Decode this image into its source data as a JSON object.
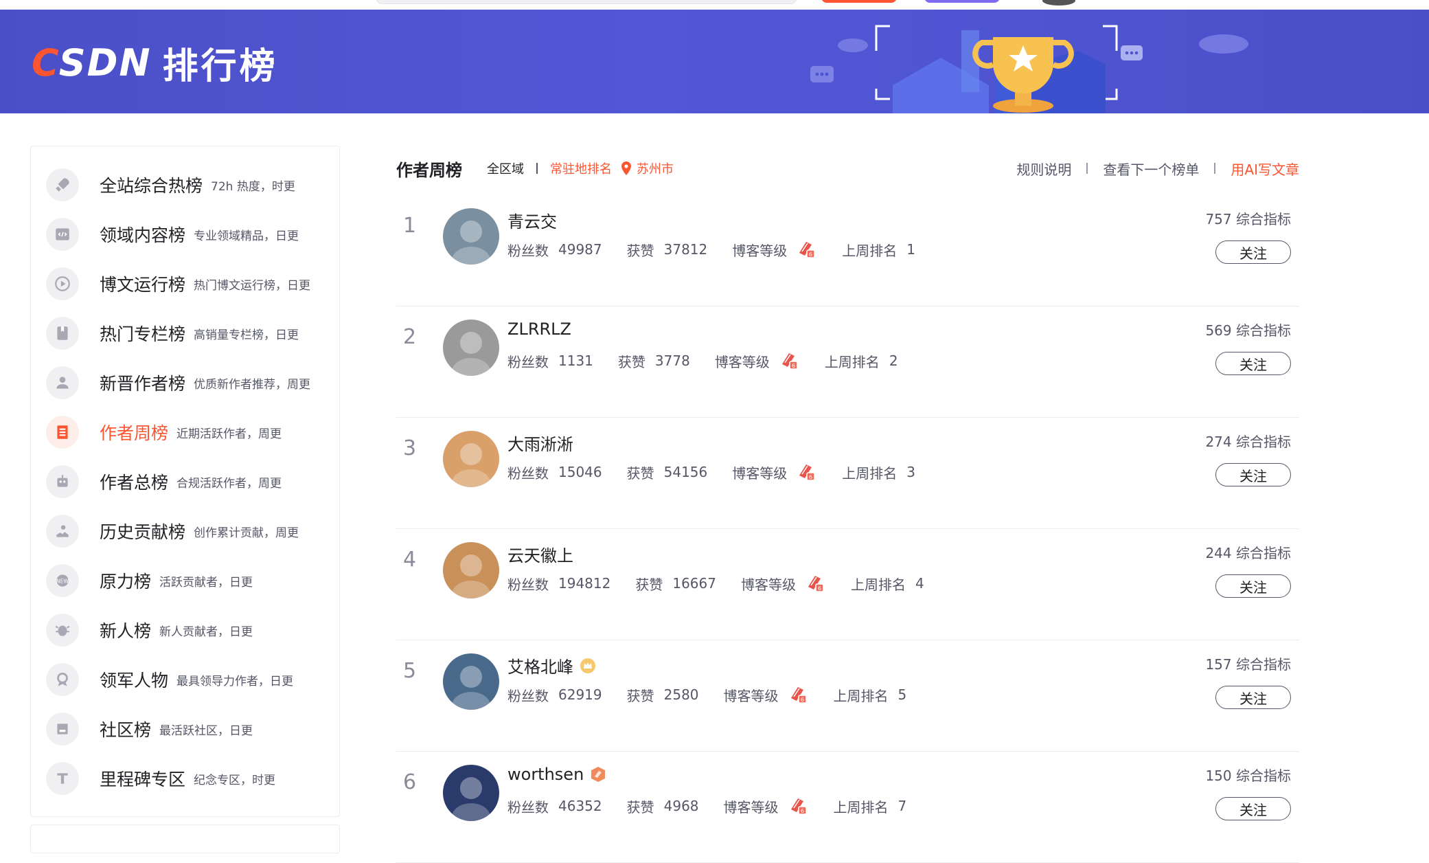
{
  "header": {
    "logo_text": "CSDN",
    "title": "排行榜"
  },
  "sidebar": {
    "items": [
      {
        "label": "全站综合热榜",
        "desc": "72h 热度，时更",
        "icon": "rocket-icon"
      },
      {
        "label": "领域内容榜",
        "desc": "专业领域精品，日更",
        "icon": "code-window-icon"
      },
      {
        "label": "博文运行榜",
        "desc": "热门博文运行榜，日更",
        "icon": "play-circle-icon"
      },
      {
        "label": "热门专栏榜",
        "desc": "高销量专栏榜，日更",
        "icon": "book-icon"
      },
      {
        "label": "新晋作者榜",
        "desc": "优质新作者推荐，周更",
        "icon": "user-icon"
      },
      {
        "label": "作者周榜",
        "desc": "近期活跃作者，周更",
        "icon": "calendar-list-icon"
      },
      {
        "label": "作者总榜",
        "desc": "合规活跃作者，周更",
        "icon": "robot-icon"
      },
      {
        "label": "历史贡献榜",
        "desc": "创作累计贡献，周更",
        "icon": "hand-up-icon"
      },
      {
        "label": "原力榜",
        "desc": "活跃贡献者，日更",
        "icon": "force-badge-icon"
      },
      {
        "label": "新人榜",
        "desc": "新人贡献者，日更",
        "icon": "bug-icon"
      },
      {
        "label": "领军人物",
        "desc": "最具领导力作者，日更",
        "icon": "medal-icon"
      },
      {
        "label": "社区榜",
        "desc": "最活跃社区，日更",
        "icon": "community-icon"
      },
      {
        "label": "里程碑专区",
        "desc": "纪念专区，时更",
        "icon": "milestone-icon"
      }
    ],
    "active_index": 5
  },
  "list_header": {
    "title": "作者周榜",
    "region": "全区域",
    "local_rank": "常驻地排名",
    "city": "苏州市",
    "rules": "规则说明",
    "next_list": "查看下一个榜单",
    "ai_write": "用AI写文章"
  },
  "labels": {
    "fans": "粉丝数",
    "likes": "获赞",
    "level": "博客等级",
    "last_rank": "上周排名",
    "score_suffix": "综合指标",
    "follow": "关注"
  },
  "authors": [
    {
      "rank": "1",
      "name": "青云交",
      "fans": "49987",
      "likes": "37812",
      "last_rank": "1",
      "score": "757",
      "badge": "",
      "avatar_color": "#7a8fa0"
    },
    {
      "rank": "2",
      "name": "ZLRRLZ",
      "fans": "1131",
      "likes": "3778",
      "last_rank": "2",
      "score": "569",
      "badge": "",
      "avatar_color": "#9a9a9a"
    },
    {
      "rank": "3",
      "name": "大雨淅淅",
      "fans": "15046",
      "likes": "54156",
      "last_rank": "3",
      "score": "274",
      "badge": "",
      "avatar_color": "#d9a06a"
    },
    {
      "rank": "4",
      "name": "云天徽上",
      "fans": "194812",
      "likes": "16667",
      "last_rank": "4",
      "score": "244",
      "badge": "",
      "avatar_color": "#c9905a"
    },
    {
      "rank": "5",
      "name": "艾格北峰",
      "fans": "62919",
      "likes": "2580",
      "last_rank": "5",
      "score": "157",
      "badge": "crown-badge-icon",
      "avatar_color": "#4a6a8c"
    },
    {
      "rank": "6",
      "name": "worthsen",
      "fans": "46352",
      "likes": "4968",
      "last_rank": "7",
      "score": "150",
      "badge": "orange-badge-icon",
      "avatar_color": "#2a3a6a"
    }
  ],
  "colors": {
    "banner": "#4f54d1",
    "accent": "#fc5531",
    "text": "#222226",
    "muted": "#555666"
  }
}
